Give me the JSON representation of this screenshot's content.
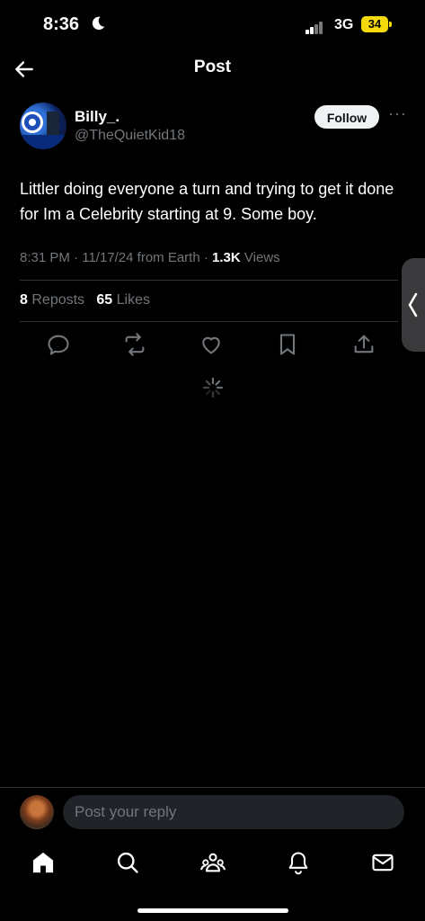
{
  "status_bar": {
    "time": "8:36",
    "network": "3G",
    "battery": "34"
  },
  "header": {
    "title": "Post"
  },
  "post": {
    "author_name": "Billy_.",
    "author_handle": "@TheQuietKid18",
    "follow_label": "Follow",
    "text": "Littler doing everyone a turn and trying to get it done for Im a Celebrity starting at 9. Some boy.",
    "time": "8:31 PM",
    "date": "11/17/24",
    "source": "from Earth",
    "views_count": "1.3K",
    "views_label": "Views",
    "reposts_count": "8",
    "reposts_label": "Reposts",
    "likes_count": "65",
    "likes_label": "Likes"
  },
  "actions": [
    "reply-icon",
    "repost-icon",
    "like-icon",
    "bookmark-icon",
    "share-icon"
  ],
  "reply": {
    "placeholder": "Post your reply"
  },
  "tabs": [
    "home-icon",
    "search-icon",
    "communities-icon",
    "notifications-icon",
    "messages-icon"
  ],
  "colors": {
    "background": "#000000",
    "text": "#e7e9ea",
    "muted": "#71767b",
    "battery": "#f5d90a"
  }
}
